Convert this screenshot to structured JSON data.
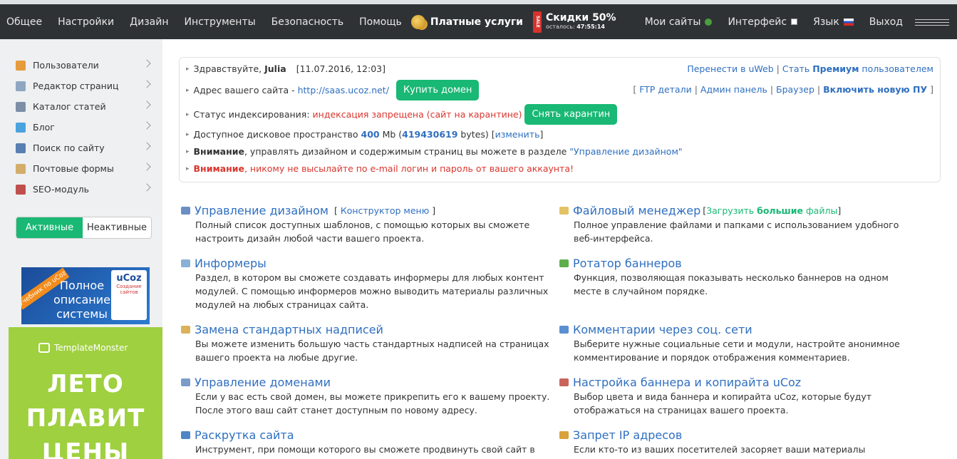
{
  "topbar": {
    "nav": [
      "Общее",
      "Настройки",
      "Дизайн",
      "Инструменты",
      "Безопасность",
      "Помощь"
    ],
    "paid": "Платные услуги",
    "sale_tag": "SALE",
    "sale_title": "Скидки 50%",
    "sale_left_label": "осталось:",
    "sale_timer": "47:55:14",
    "right": {
      "my_sites": "Мои сайты",
      "interface": "Интерфейс",
      "language": "Язык",
      "logout": "Выход"
    }
  },
  "sidebar": {
    "items": [
      {
        "label": "Пользователи",
        "color": "#e59c3c"
      },
      {
        "label": "Редактор страниц",
        "color": "#8fa6c3"
      },
      {
        "label": "Каталог статей",
        "color": "#7c8fa6"
      },
      {
        "label": "Блог",
        "color": "#4aa3df"
      },
      {
        "label": "Поиск по сайту",
        "color": "#5a7fb3"
      },
      {
        "label": "Почтовые формы",
        "color": "#d3ad6a"
      },
      {
        "label": "SEO-модуль",
        "color": "#c0504d"
      }
    ],
    "toggle_active": "Активные",
    "toggle_inactive": "Неактивные",
    "banner1": {
      "ribbon": "Учебник по uCoz",
      "text": "Полное описание системы",
      "brand": "uCoz",
      "brand_sub": "Создание сайтов"
    },
    "banner2": {
      "brand": "TemplateMonster",
      "line1": "ЛЕТО",
      "line2": "ПЛАВИТ",
      "line3": "ЦЕНЫ"
    }
  },
  "info": {
    "greeting": "Здравствуйте,",
    "user": "Julia",
    "datetime": "[11.07.2016, 12:03]",
    "address_label": "Адрес вашего сайта -",
    "address_url": "http://saas.ucoz.net/",
    "buy_domain": "Купить домен",
    "index_label": "Статус индексирования:",
    "index_status": "индексация запрещена (сайт на карантине)",
    "remove_quarantine": "Снять карантин",
    "disk_label": "Доступное дисковое пространство",
    "disk_mb": "400",
    "disk_mb_unit": "Mb (",
    "disk_bytes": "419430619",
    "disk_bytes_unit": "bytes) [",
    "disk_change": "изменить",
    "disk_close": "]",
    "warn1_bold": "Внимание",
    "warn1_text": ", управлять дизайном и содержимым страниц вы можете в разделе",
    "warn1_link": "\"Управление дизайном\"",
    "warn2_bold": "Внимание",
    "warn2_text": ", никому не высылайте по e-mail логин и пароль от вашего аккаунта!",
    "r1_link1": "Перенести в uWeb",
    "r1_sep": "|",
    "r1_link2a": "Стать",
    "r1_link2b": "Премиум",
    "r1_link2c": "пользователем",
    "r2_open": "[",
    "r2_ftp": "FTP детали",
    "r2_admin": "Админ панель",
    "r2_browser": "Браузер",
    "r2_new": "Включить новую ПУ",
    "r2_close": "]"
  },
  "sections": {
    "left": [
      {
        "title": "Управление дизайном",
        "sub_open": "[",
        "sub_link": "Конструктор меню",
        "sub_close": "]",
        "desc": "Полный список доступных шаблонов, с помощью которых вы сможете настроить дизайн любой части вашего проекта.",
        "color": "#6b8fc4"
      },
      {
        "title": "Информеры",
        "desc": "Раздел, в котором вы сможете создавать информеры для любых контент модулей. С помощью информеров можно выводить материалы различных модулей на любых страницах сайта.",
        "color": "#8ab0d6"
      },
      {
        "title": "Замена стандартных надписей",
        "desc": "Вы можете изменить большую часть стандартных надписей на страницах вашего проекта на любые другие.",
        "color": "#d9b25a"
      },
      {
        "title": "Управление доменами",
        "desc": "Если у вас есть свой домен, вы можете прикрепить его к вашему проекту. После этого ваш сайт станет доступным по новому адресу.",
        "color": "#7c9cc8"
      },
      {
        "title": "Раскрутка сайта",
        "desc": "Инструмент, при помощи которого вы сможете продвинуть свой сайт в",
        "color": "#4f86c6"
      }
    ],
    "right": [
      {
        "title": "Файловый менеджер",
        "sub_open": "[",
        "sub_a": "Загрузить",
        "sub_b": "большие",
        "sub_c": "файлы",
        "sub_close": "]",
        "desc": "Полное управление файлами и папками с использованием удобного веб-интерфейса.",
        "color": "#e3c266"
      },
      {
        "title": "Ротатор баннеров",
        "desc": "Функция, позволяющая показывать несколько баннеров на одном месте в случайном порядке.",
        "color": "#5fae4e"
      },
      {
        "title": "Комментарии через соц. сети",
        "desc": "Выберите нужные социальные сети и модули, настройте анонимное комментирование и порядок отображения комментариев.",
        "color": "#5b8fd1"
      },
      {
        "title": "Настройка баннера и копирайта uCoz",
        "desc": "Выбор цвета и вида баннера и копирайта uCoz, которые будут отображаться на страницах вашего проекта.",
        "color": "#c9645b"
      },
      {
        "title": "Запрет IP адресов",
        "desc": "Если кто-то из ваших посетителей засоряет ваши материалы неуместными",
        "color": "#d8a13a"
      }
    ]
  }
}
